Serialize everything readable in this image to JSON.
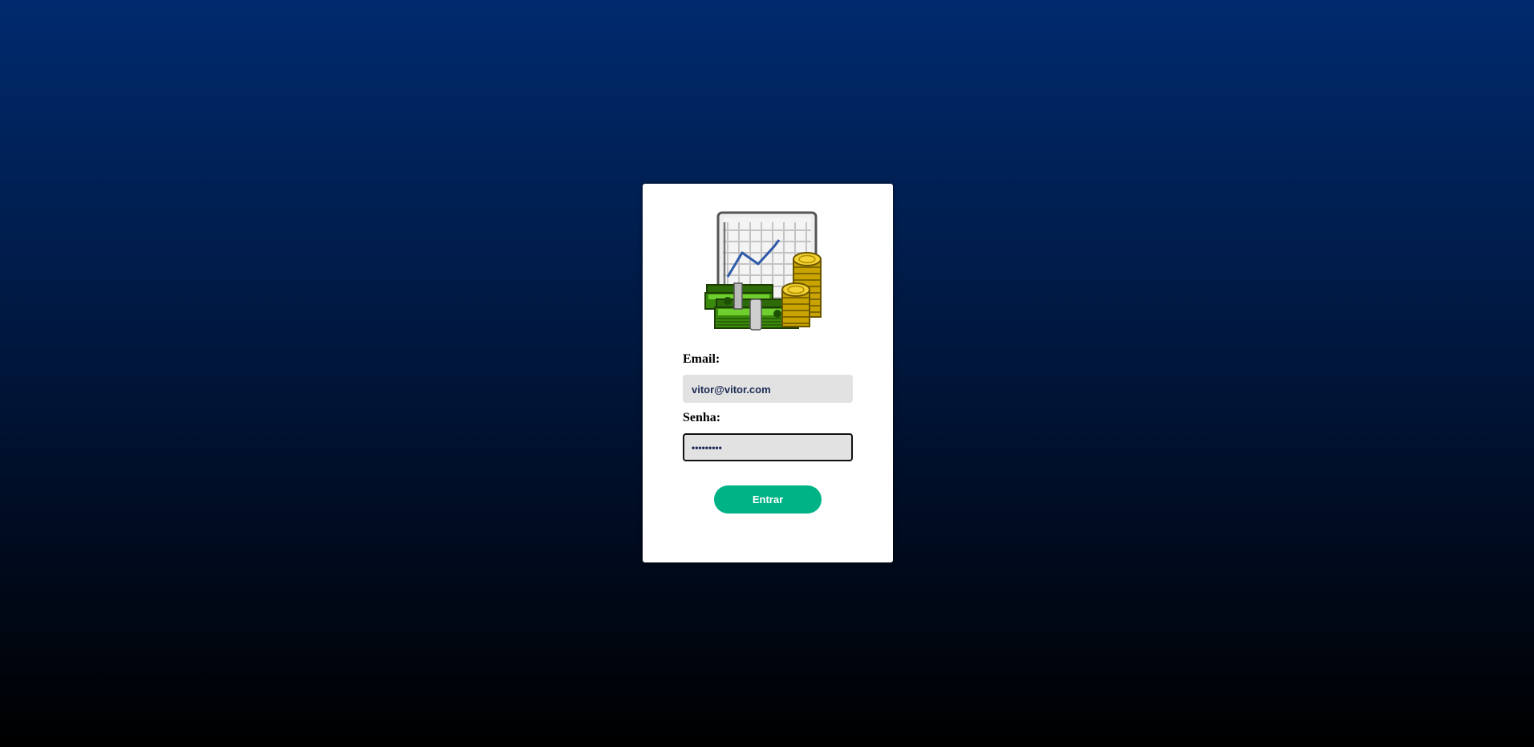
{
  "login": {
    "logo_icon": "finance-chart-money-icon",
    "email_label": "Email:",
    "email_value": "vitor@vitor.com",
    "password_label": "Senha:",
    "password_value": "•••••••••",
    "submit_label": "Entrar"
  },
  "colors": {
    "background_top": "#002a6e",
    "background_bottom": "#000000",
    "card": "#ffffff",
    "input_bg": "#e2e2e2",
    "input_text": "#1c2b55",
    "button": "#00b386",
    "button_text": "#ffffff"
  }
}
